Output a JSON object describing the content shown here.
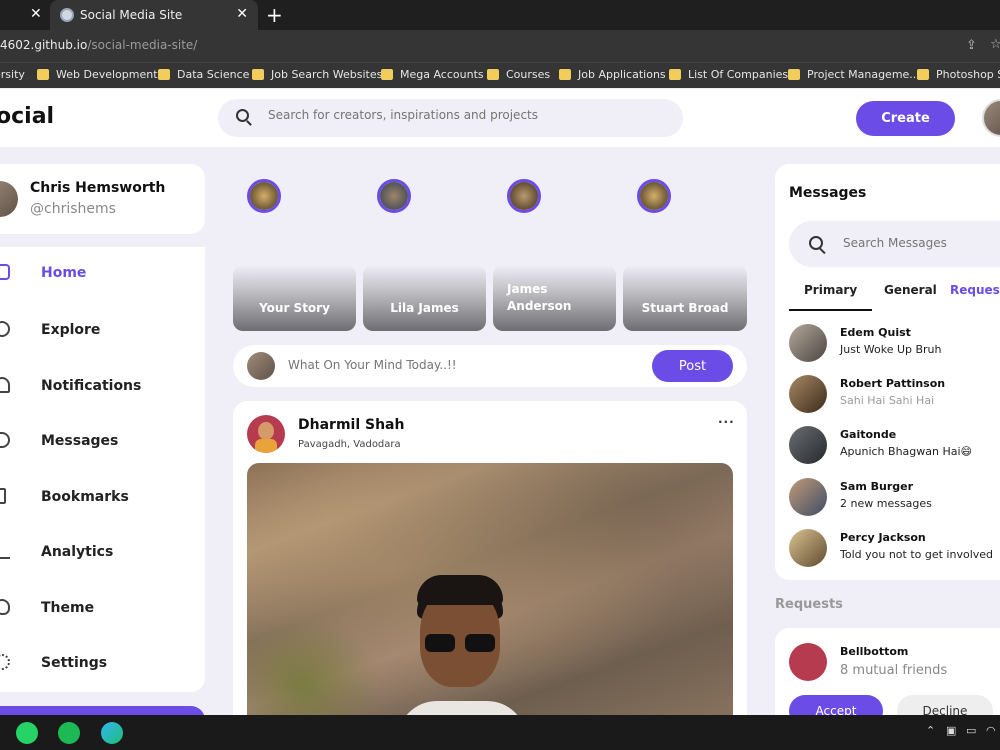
{
  "browser": {
    "tab_title": "Social Media Site",
    "tab_close": "✕",
    "left_close": "✕",
    "new_tab": "+",
    "url_domain": "4602.github.io",
    "url_path": "/social-media-site/",
    "bookmarks": [
      {
        "label": "ersity"
      },
      {
        "label": "Web Development"
      },
      {
        "label": "Data Science"
      },
      {
        "label": "Job Search Websites"
      },
      {
        "label": "Mega Accounts"
      },
      {
        "label": "Courses"
      },
      {
        "label": "Job Applications"
      },
      {
        "label": "List Of Companies"
      },
      {
        "label": "Project Manageme..."
      },
      {
        "label": "Photoshop Sit"
      }
    ]
  },
  "navbar": {
    "logo": "ocial",
    "search_placeholder": "Search for creators, inspirations and projects",
    "create_label": "Create"
  },
  "profile": {
    "name": "Chris Hemsworth",
    "handle": "@chrishems"
  },
  "sidebar": {
    "items": [
      {
        "label": "Home",
        "icon": "home-icon"
      },
      {
        "label": "Explore",
        "icon": "compass-icon"
      },
      {
        "label": "Notifications",
        "icon": "bell-icon"
      },
      {
        "label": "Messages",
        "icon": "send-icon"
      },
      {
        "label": "Bookmarks",
        "icon": "bookmark-icon"
      },
      {
        "label": "Analytics",
        "icon": "chart-icon"
      },
      {
        "label": "Theme",
        "icon": "palette-icon"
      },
      {
        "label": "Settings",
        "icon": "gear-icon"
      }
    ]
  },
  "stories": {
    "cards": [
      {
        "name": "Your Story"
      },
      {
        "name": "Lila James"
      },
      {
        "name": "James Anderson"
      },
      {
        "name": "Stuart Broad"
      }
    ]
  },
  "create_post": {
    "placeholder": "What On Your Mind Today..!!",
    "post_label": "Post"
  },
  "feed": {
    "author": "Dharmil Shah",
    "location": "Pavagadh, Vadodara",
    "more": "···"
  },
  "messages": {
    "title": "Messages",
    "search_placeholder": "Search Messages",
    "tabs": [
      "Primary",
      "General",
      "Request"
    ],
    "items": [
      {
        "name": "Edem Quist",
        "text": "Just Woke Up Bruh",
        "muted": false
      },
      {
        "name": "Robert Pattinson",
        "text": "Sahi Hai Sahi Hai",
        "muted": true
      },
      {
        "name": "Gaitonde",
        "text": "Apunich Bhagwan Hai😄",
        "muted": false
      },
      {
        "name": "Sam Burger",
        "text": "2 new messages",
        "muted": false
      },
      {
        "name": "Percy Jackson",
        "text": "Told you not to get involved",
        "muted": false
      }
    ]
  },
  "requests": {
    "title": "Requests",
    "name": "Bellbottom",
    "subtitle": "8 mutual friends",
    "accept_label": "Accept",
    "decline_label": "Decline"
  },
  "colors": {
    "primary": "#6b4ce6",
    "background": "#f0eef6"
  }
}
